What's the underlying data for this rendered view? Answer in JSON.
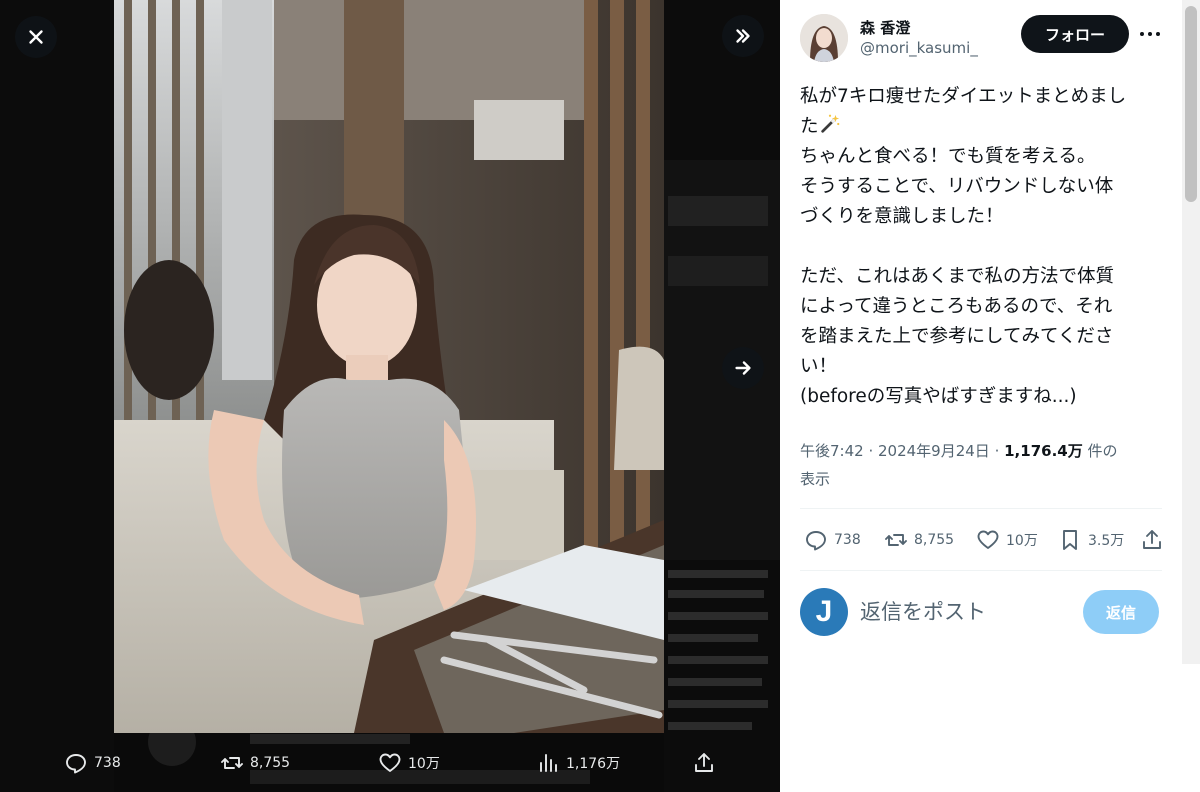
{
  "viewer": {
    "icons": {
      "close": "close-icon",
      "expand": "double-chevron-right-icon",
      "next": "arrow-right-icon"
    },
    "media_actions": {
      "replies": "738",
      "reposts": "8,755",
      "likes": "10万",
      "views": "1,176万"
    }
  },
  "tweet": {
    "author": {
      "display_name": "森 香澄",
      "handle": "@mori_kasumi_"
    },
    "follow_label": "フォロー",
    "text_lines": [
      "私が7キロ痩せたダイエットまとめまし",
      "た",
      "ちゃんと食べる！でも質を考える。",
      "そうすることで、リバウンドしない体",
      "づくりを意識しました！",
      "ただ、これはあくまで私の方法で体質",
      "によって違うところもあるので、それ",
      "を踏まえた上で参考にしてみてくださ",
      "い！",
      "(beforeの写真やばすぎますね...)"
    ],
    "meta": {
      "time": "午後7:42",
      "sep": " · ",
      "date": "2024年9月24日",
      "views_count": "1,176.4万",
      "views_suffix": " 件の",
      "views_line2": "表示"
    },
    "actions": {
      "replies": "738",
      "reposts": "8,755",
      "likes": "10万",
      "bookmarks": "3.5万"
    },
    "reply": {
      "avatar_letter": "J",
      "placeholder": "返信をポスト",
      "button_label": "返信"
    }
  }
}
